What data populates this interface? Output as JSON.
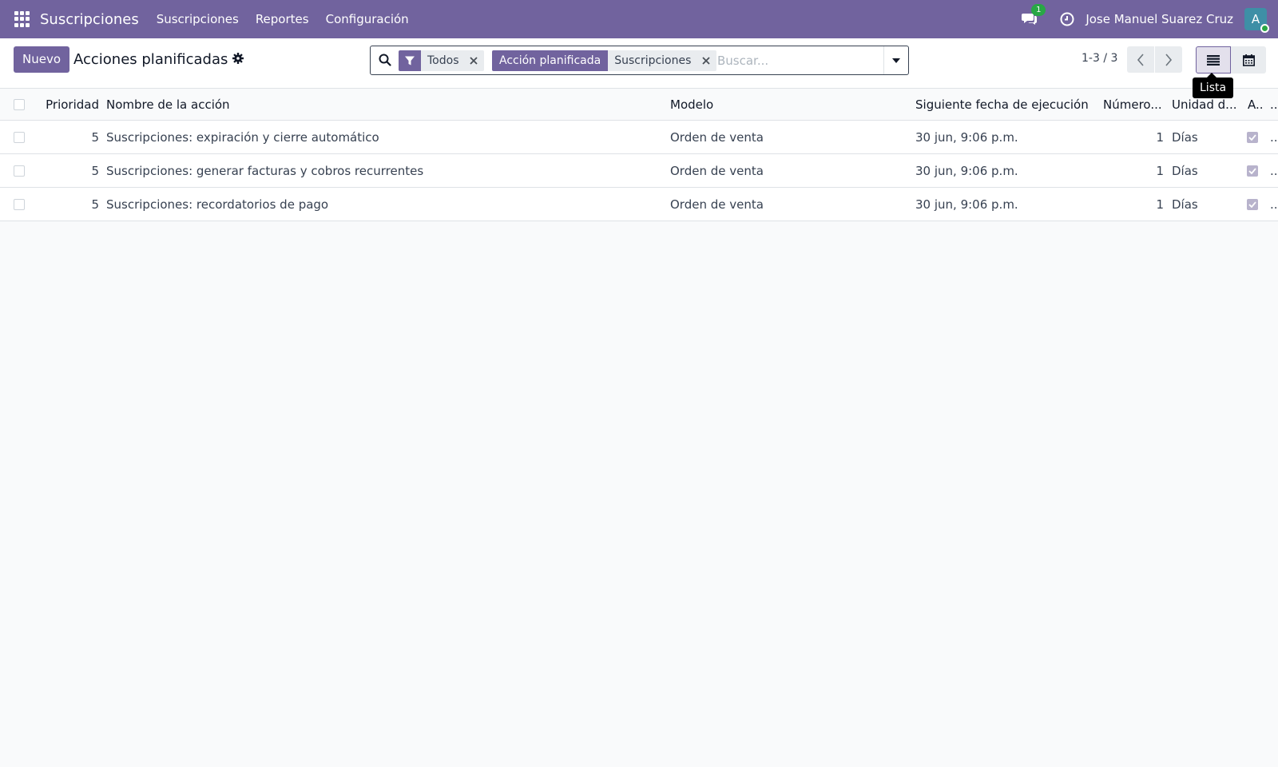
{
  "navbar": {
    "app_name": "Suscripciones",
    "menu": [
      "Suscripciones",
      "Reportes",
      "Configuración"
    ],
    "chat_badge": "1",
    "user_name": "Jose Manuel Suarez Cruz",
    "avatar_initial": "A"
  },
  "control_panel": {
    "new_button": "Nuevo",
    "title": "Acciones planificadas",
    "facets": [
      {
        "icon": "filter-icon",
        "values": "Todos"
      },
      {
        "label": "Acción planificada",
        "values": "Suscripciones"
      }
    ],
    "search_placeholder": "Buscar...",
    "pager": "1-3 / 3",
    "tooltip": "Lista"
  },
  "table": {
    "columns": [
      "Prioridad",
      "Nombre de la acción",
      "Modelo",
      "Siguiente fecha de ejecución",
      "Número...",
      "Unidad d...",
      "A..",
      ".."
    ],
    "rows": [
      {
        "priority": "5",
        "name": "Suscripciones: expiración y cierre automático",
        "model": "Orden de venta",
        "next_date": "30 jun, 9:06 p.m.",
        "number": "1",
        "unit": "Días",
        "active": true,
        "more": ".."
      },
      {
        "priority": "5",
        "name": "Suscripciones: generar facturas y cobros recurrentes",
        "model": "Orden de venta",
        "next_date": "30 jun, 9:06 p.m.",
        "number": "1",
        "unit": "Días",
        "active": true,
        "more": ".."
      },
      {
        "priority": "5",
        "name": "Suscripciones: recordatorios de pago",
        "model": "Orden de venta",
        "next_date": "30 jun, 9:06 p.m.",
        "number": "1",
        "unit": "Días",
        "active": true,
        "more": ".."
      }
    ]
  },
  "colors": {
    "brand": "#71639e",
    "badge": "#28a745"
  }
}
